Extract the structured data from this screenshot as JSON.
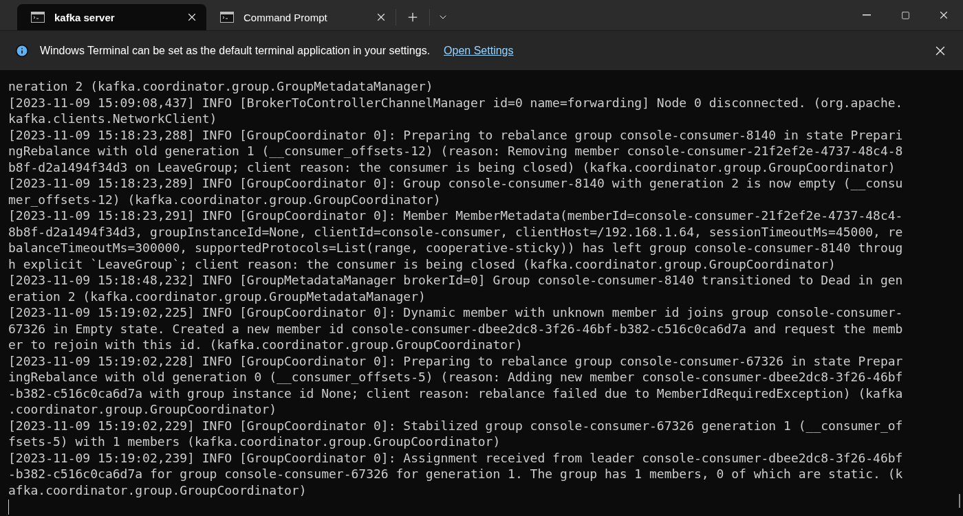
{
  "tabs": [
    {
      "title": "kafka server",
      "selected": true
    },
    {
      "title": "Command Prompt",
      "selected": false
    }
  ],
  "notification": {
    "message": "Windows Terminal can be set as the default terminal application in your settings.",
    "link": "Open Settings"
  },
  "terminal": {
    "lines": [
      "neration 2 (kafka.coordinator.group.GroupMetadataManager)",
      "[2023-11-09 15:09:08,437] INFO [BrokerToControllerChannelManager id=0 name=forwarding] Node 0 disconnected. (org.apache.",
      "kafka.clients.NetworkClient)",
      "[2023-11-09 15:18:23,288] INFO [GroupCoordinator 0]: Preparing to rebalance group console-consumer-8140 in state Prepari",
      "ngRebalance with old generation 1 (__consumer_offsets-12) (reason: Removing member console-consumer-21f2ef2e-4737-48c4-8",
      "b8f-d2a1494f34d3 on LeaveGroup; client reason: the consumer is being closed) (kafka.coordinator.group.GroupCoordinator)",
      "[2023-11-09 15:18:23,289] INFO [GroupCoordinator 0]: Group console-consumer-8140 with generation 2 is now empty (__consu",
      "mer_offsets-12) (kafka.coordinator.group.GroupCoordinator)",
      "[2023-11-09 15:18:23,291] INFO [GroupCoordinator 0]: Member MemberMetadata(memberId=console-consumer-21f2ef2e-4737-48c4-",
      "8b8f-d2a1494f34d3, groupInstanceId=None, clientId=console-consumer, clientHost=/192.168.1.64, sessionTimeoutMs=45000, re",
      "balanceTimeoutMs=300000, supportedProtocols=List(range, cooperative-sticky)) has left group console-consumer-8140 throug",
      "h explicit `LeaveGroup`; client reason: the consumer is being closed (kafka.coordinator.group.GroupCoordinator)",
      "[2023-11-09 15:18:48,232] INFO [GroupMetadataManager brokerId=0] Group console-consumer-8140 transitioned to Dead in gen",
      "eration 2 (kafka.coordinator.group.GroupMetadataManager)",
      "[2023-11-09 15:19:02,225] INFO [GroupCoordinator 0]: Dynamic member with unknown member id joins group console-consumer-",
      "67326 in Empty state. Created a new member id console-consumer-dbee2dc8-3f26-46bf-b382-c516c0ca6d7a and request the memb",
      "er to rejoin with this id. (kafka.coordinator.group.GroupCoordinator)",
      "[2023-11-09 15:19:02,228] INFO [GroupCoordinator 0]: Preparing to rebalance group console-consumer-67326 in state Prepar",
      "ingRebalance with old generation 0 (__consumer_offsets-5) (reason: Adding new member console-consumer-dbee2dc8-3f26-46bf",
      "-b382-c516c0ca6d7a with group instance id None; client reason: rebalance failed due to MemberIdRequiredException) (kafka",
      ".coordinator.group.GroupCoordinator)",
      "[2023-11-09 15:19:02,229] INFO [GroupCoordinator 0]: Stabilized group console-consumer-67326 generation 1 (__consumer_of",
      "fsets-5) with 1 members (kafka.coordinator.group.GroupCoordinator)",
      "[2023-11-09 15:19:02,239] INFO [GroupCoordinator 0]: Assignment received from leader console-consumer-dbee2dc8-3f26-46bf",
      "-b382-c516c0ca6d7a for group console-consumer-67326 for generation 1. The group has 1 members, 0 of which are static. (k",
      "afka.coordinator.group.GroupCoordinator)"
    ]
  }
}
